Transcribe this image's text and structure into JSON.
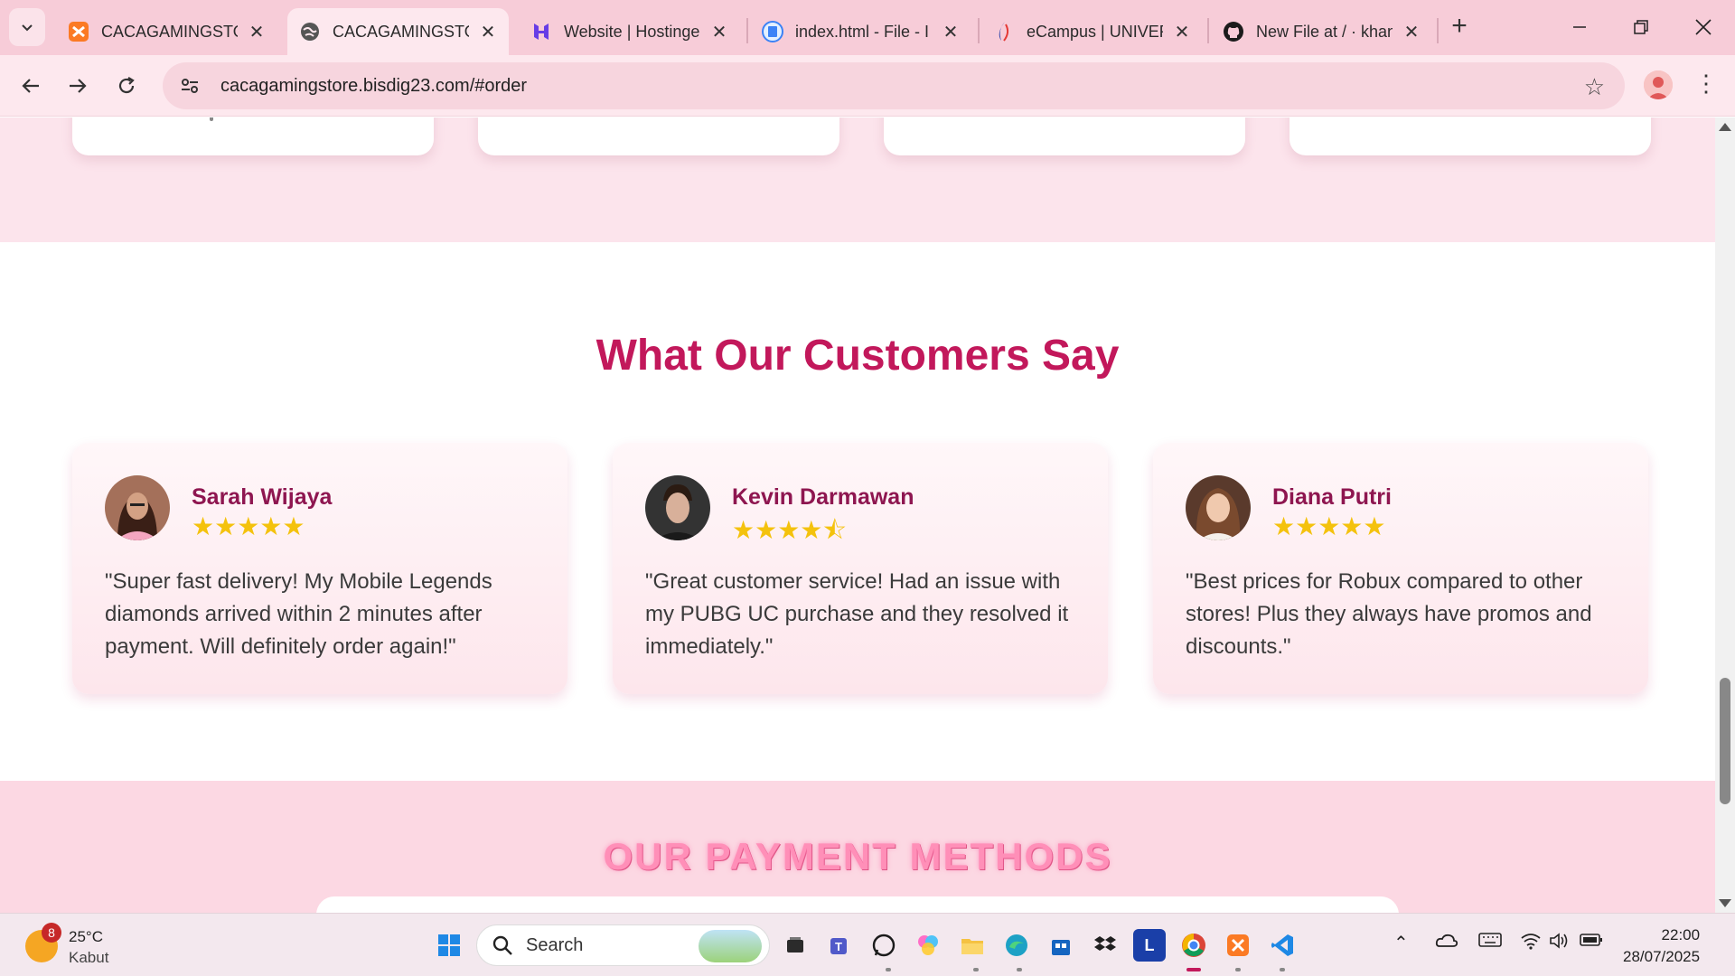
{
  "browser": {
    "tabs": [
      {
        "title": "CACAGAMINGSTORE",
        "icon": "xampp-icon",
        "active": false
      },
      {
        "title": "CACAGAMINGSTORE",
        "icon": "globe-icon",
        "active": true
      },
      {
        "title": "Website | Hostinger",
        "icon": "hostinger-icon",
        "active": false
      },
      {
        "title": "index.html - File - I",
        "icon": "file-manager-icon",
        "active": false
      },
      {
        "title": "eCampus | UNIVERSITAS",
        "icon": "ecampus-icon",
        "active": false
      },
      {
        "title": "New File at / · khan",
        "icon": "github-icon",
        "active": false
      }
    ],
    "url": "cacagamingstore.bisdig23.com/#order"
  },
  "page": {
    "testimonials": {
      "title": "What Our Customers Say",
      "items": [
        {
          "name": "Sarah Wijaya",
          "rating": 5,
          "stars": "★★★★★",
          "quote": "\"Super fast delivery! My Mobile Legends diamonds arrived within 2 minutes after payment. Will definitely order again!\""
        },
        {
          "name": "Kevin Darmawan",
          "rating": 4.5,
          "stars": "★★★★⯪",
          "quote": "\"Great customer service! Had an issue with my PUBG UC purchase and they resolved it immediately.\""
        },
        {
          "name": "Diana Putri",
          "rating": 5,
          "stars": "★★★★★",
          "quote": "\"Best prices for Robux compared to other stores! Plus they always have promos and discounts.\""
        }
      ]
    },
    "payment": {
      "title": "OUR PAYMENT METHODS"
    }
  },
  "taskbar": {
    "weather": {
      "temp": "25°C",
      "condition": "Kabut",
      "badge": "8"
    },
    "search_label": "Search",
    "time": "22:00",
    "date": "28/07/2025"
  },
  "colors": {
    "accent": "#c2185b",
    "pink_bg": "#fce4ec",
    "star": "#f4c20d"
  }
}
